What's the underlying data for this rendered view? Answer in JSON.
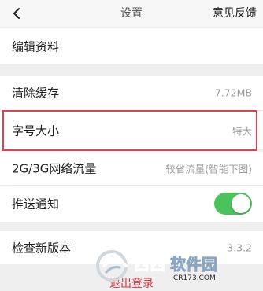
{
  "header": {
    "back_icon": "chevron-left-icon",
    "title": "设置",
    "feedback_label": "意见反馈"
  },
  "rows": {
    "edit_profile": {
      "label": "编辑资料"
    },
    "clear_cache": {
      "label": "清除缓存",
      "value": "7.72MB"
    },
    "font_size": {
      "label": "字号大小",
      "value": "特大"
    },
    "traffic": {
      "label": "2G/3G网络流量",
      "value": "较省流量(智能下图)"
    },
    "push": {
      "label": "推送通知",
      "enabled": true
    },
    "version": {
      "label": "检查新版本",
      "value": "3.3.2"
    }
  },
  "logout_label": "退出登录",
  "watermark": {
    "brand": "西西软件园",
    "site": "CR173.COM"
  },
  "colors": {
    "accent_green": "#4cc25d",
    "highlight_red": "#d8434e",
    "logout_red": "#d9343f"
  }
}
